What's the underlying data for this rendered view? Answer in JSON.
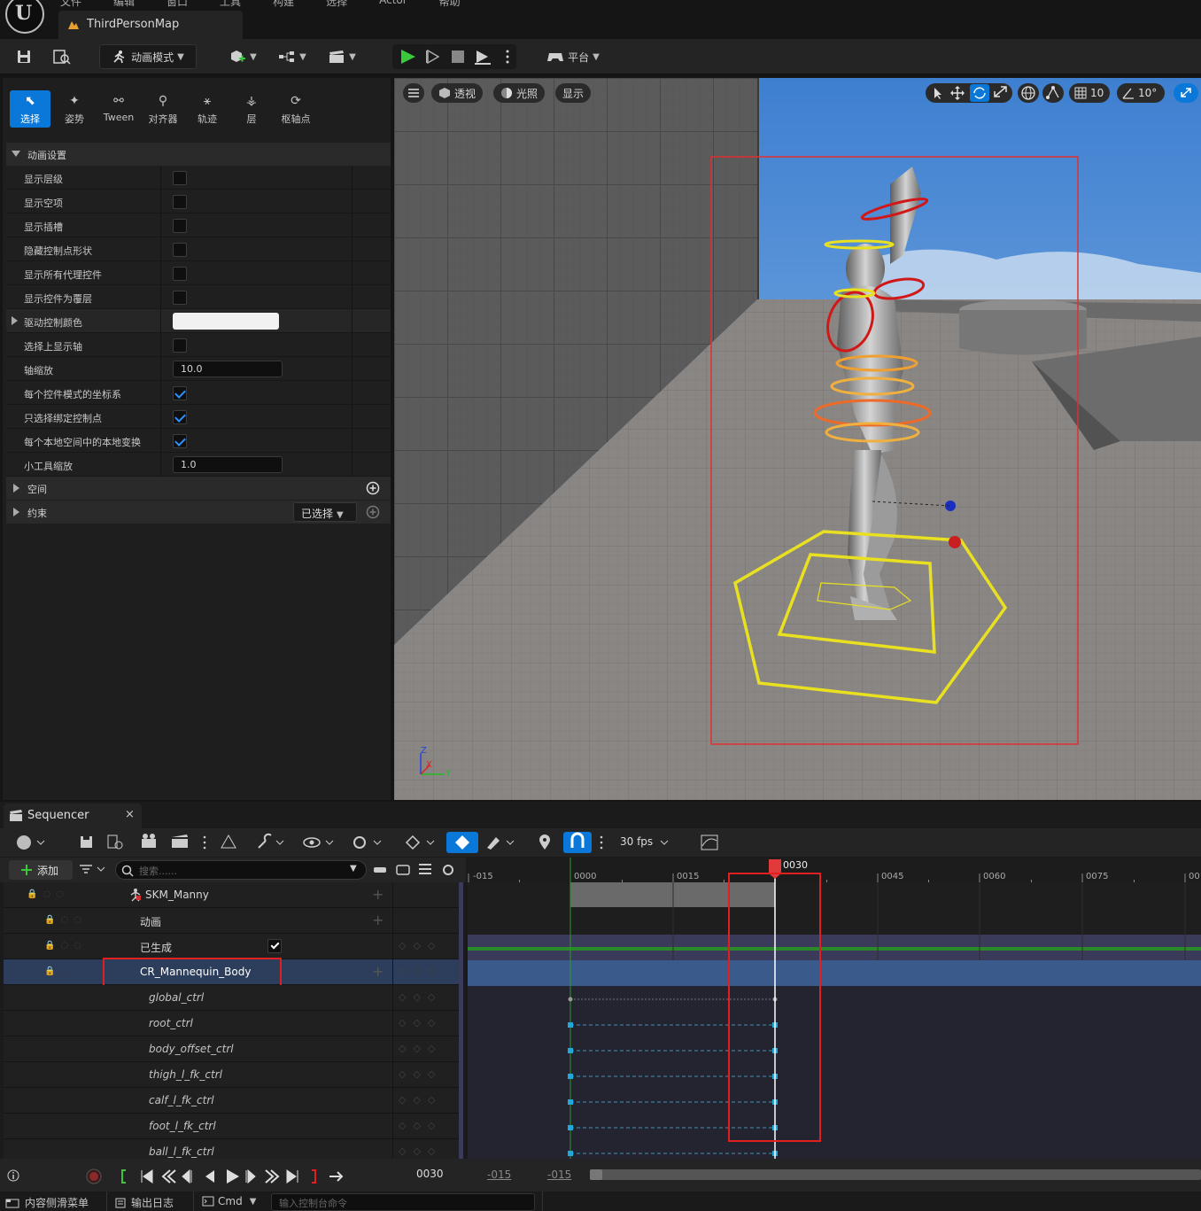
{
  "menu": [
    "文件",
    "编辑",
    "窗口",
    "工具",
    "构建",
    "选择",
    "Actor",
    "帮助"
  ],
  "map_tab": "ThirdPersonMap",
  "toolbar": {
    "mode_label": "动画模式",
    "platform_label": "平台"
  },
  "modes": [
    "选择",
    "姿势",
    "Tween",
    "对齐器",
    "轨迹",
    "层",
    "枢轴点"
  ],
  "animation_settings": {
    "header": "动画设置",
    "rows": [
      {
        "label": "显示层级",
        "checked": false
      },
      {
        "label": "显示空项",
        "checked": false
      },
      {
        "label": "显示插槽",
        "checked": false
      },
      {
        "label": "隐藏控制点形状",
        "checked": false
      },
      {
        "label": "显示所有代理控件",
        "checked": false
      },
      {
        "label": "显示控件为覆层",
        "checked": false
      }
    ],
    "driver_color_label": "驱动控制颜色",
    "show_axis_label": "选择上显示轴",
    "axis_scale_label": "轴缩放",
    "axis_scale_value": "10.0",
    "coord_label": "每个控件模式的坐标系",
    "only_bound_label": "只选择绑定控制点",
    "local_label": "每个本地空间中的本地变换",
    "gizmo_scale_label": "小工具缩放",
    "gizmo_scale_value": "1.0",
    "space_label": "空间",
    "constraint_label": "约束",
    "selected_dropdown": "已选择"
  },
  "viewport": {
    "perspective": "透视",
    "lighting": "光照",
    "show": "显示",
    "grid_value": "10",
    "angle_value": "10°",
    "axis_z": "Z",
    "axis_x": "X",
    "axis_y": "Y"
  },
  "sequencer": {
    "tab": "Sequencer",
    "close": "×",
    "add": "添加",
    "search_placeholder": "搜索......",
    "fps": "30 fps",
    "tracks": [
      {
        "name": "SKM_Manny"
      },
      {
        "name": "动画"
      },
      {
        "name": "已生成"
      },
      {
        "name": "CR_Mannequin_Body"
      },
      {
        "name": "global_ctrl"
      },
      {
        "name": "root_ctrl"
      },
      {
        "name": "body_offset_ctrl"
      },
      {
        "name": "thigh_l_fk_ctrl"
      },
      {
        "name": "calf_l_fk_ctrl"
      },
      {
        "name": "foot_l_fk_ctrl"
      },
      {
        "name": "ball_l_fk_ctrl"
      }
    ],
    "ticks": [
      "-015",
      "0000",
      "0015",
      "0030",
      "0045",
      "0060",
      "0075",
      "00"
    ],
    "playhead": "0030",
    "current_frame": "0030",
    "range_start": "-015",
    "range_end": "-015"
  },
  "bottom": {
    "content_drawer": "内容侧滑菜单",
    "output_log": "输出日志",
    "cmd": "Cmd",
    "cmd_placeholder": "输入控制台命令"
  }
}
